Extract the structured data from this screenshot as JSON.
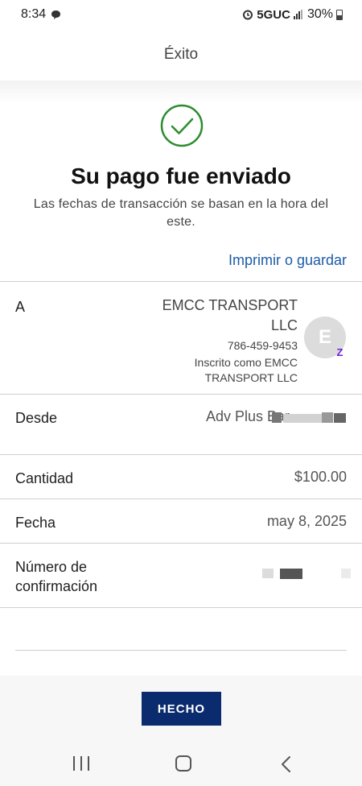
{
  "status_bar": {
    "time": "8:34",
    "network": "5GUC",
    "battery": "30%"
  },
  "header": {
    "title": "Éxito"
  },
  "success": {
    "title": "Su pago fue enviado",
    "subtitle": "Las fechas de transacción se basan en la hora del este.",
    "print_link": "Imprimir o guardar"
  },
  "details": {
    "to": {
      "label": "A",
      "name": "EMCC TRANSPORT LLC",
      "phone": "786-459-9453",
      "enrolled": "Inscrito como EMCC TRANSPORT LLC",
      "avatar_initial": "E",
      "badge": "Z"
    },
    "from": {
      "label": "Desde",
      "value": "Adv Plus Bar"
    },
    "amount": {
      "label": "Cantidad",
      "value": "$100.00"
    },
    "date": {
      "label": "Fecha",
      "value": "may 8, 2025"
    },
    "confirmation": {
      "label": "Número de confirmación"
    }
  },
  "actions": {
    "done_label": "HECHO"
  },
  "nav": {
    "recents_icon": "recents-icon",
    "home_icon": "home-icon",
    "back_icon": "back-icon"
  },
  "colors": {
    "brand_button": "#0a2c6e",
    "link": "#1d5ca8",
    "success": "#2e8b2e",
    "zelle": "#6d1ed4"
  }
}
